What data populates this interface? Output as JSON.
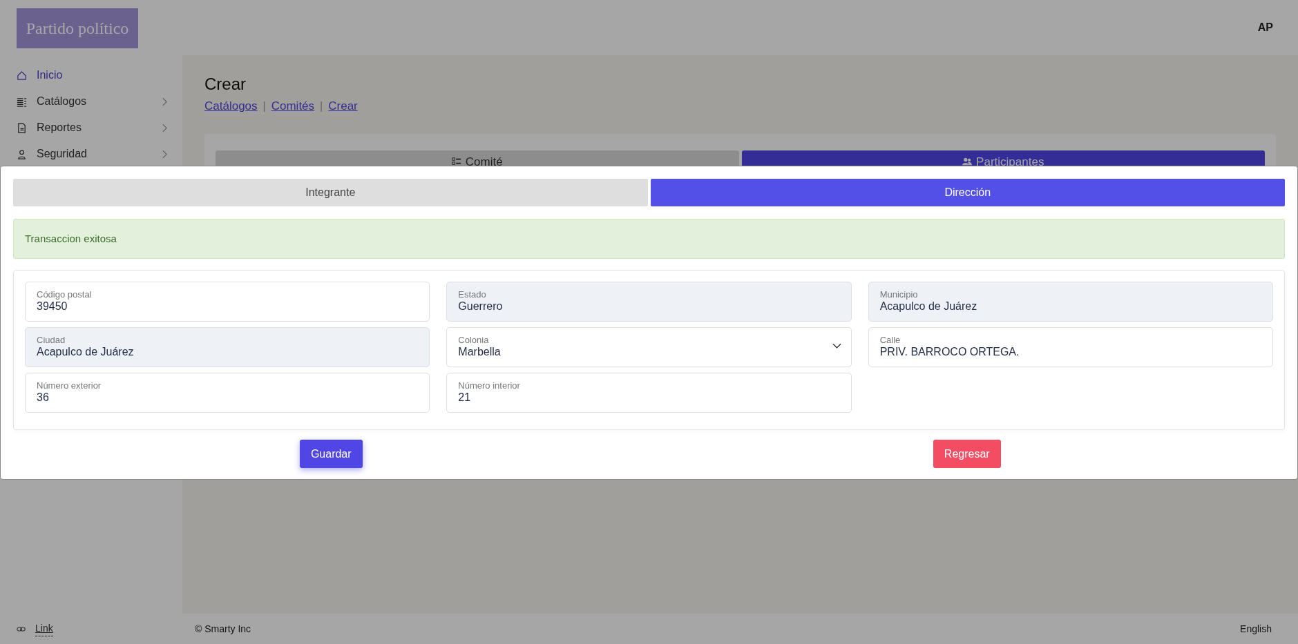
{
  "logo": "Partido político",
  "sidebar": {
    "items": [
      {
        "label": "Inicio",
        "selected": true,
        "has_submenu": false
      },
      {
        "label": "Catálogos",
        "selected": false,
        "has_submenu": true
      },
      {
        "label": "Reportes",
        "selected": false,
        "has_submenu": true
      },
      {
        "label": "Seguridad",
        "selected": false,
        "has_submenu": true
      }
    ],
    "link": "Link"
  },
  "header": {
    "avatar": "AP"
  },
  "page": {
    "title": "Crear",
    "breadcrumbs": [
      "Catálogos",
      "Comités",
      "Crear"
    ],
    "breadcrumb_separators": [
      "|",
      "|"
    ],
    "tabs": [
      {
        "label": "Comité",
        "selected": false
      },
      {
        "label": "Participantes",
        "selected": true
      }
    ]
  },
  "modal": {
    "tabs": [
      {
        "label": "Integrante",
        "selected": false
      },
      {
        "label": "Dirección",
        "selected": true
      }
    ],
    "alert": "Transaccion exitosa",
    "fields": [
      {
        "label": "Código postal",
        "value": "39450",
        "kind": "input",
        "readonly": false
      },
      {
        "label": "Estado",
        "value": "Guerrero",
        "kind": "input",
        "readonly": true
      },
      {
        "label": "Municipio",
        "value": "Acapulco de Juárez",
        "kind": "input",
        "readonly": true
      },
      {
        "label": "Ciudad",
        "value": "Acapulco de Juárez",
        "kind": "input",
        "readonly": true
      },
      {
        "label": "Colonia",
        "value": "Marbella",
        "kind": "select",
        "readonly": false
      },
      {
        "label": "Calle",
        "value": "PRIV. BARROCO ORTEGA.",
        "kind": "input",
        "readonly": false
      },
      {
        "label": "Número exterior",
        "value": "36",
        "kind": "input",
        "readonly": false
      },
      {
        "label": "Número interior",
        "value": "21",
        "kind": "input",
        "readonly": false
      }
    ],
    "buttons": [
      {
        "label": "Guardar",
        "kind": "primary"
      },
      {
        "label": "Regresar",
        "kind": "danger"
      }
    ]
  },
  "footer": {
    "copyright": "© Smarty Inc",
    "language": "English"
  }
}
